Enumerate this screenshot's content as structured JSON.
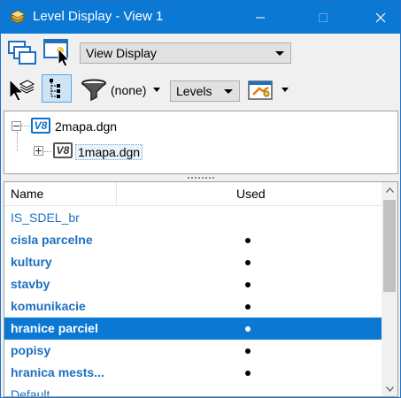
{
  "window": {
    "title": "Level Display - View 1",
    "icon": "level-stack-icon"
  },
  "toolbar": {
    "view_display": "View Display",
    "filter_value": "(none)",
    "mode_select": "Levels",
    "icons": [
      "view-group-icon",
      "view-select-icon",
      "element-select-icon",
      "tree-toggle-icon",
      "filter-icon",
      "settings-icon"
    ]
  },
  "tree": {
    "root": {
      "icon": "v8-icon",
      "label": "2mapa.dgn"
    },
    "child": {
      "icon": "v8-icon",
      "label": "1mapa.dgn"
    }
  },
  "list": {
    "col_name": "Name",
    "col_used": "Used",
    "rows": [
      {
        "name": "IS_SDEL_br",
        "bold": false,
        "used": false,
        "selected": false
      },
      {
        "name": "cisla parcelne",
        "bold": true,
        "used": true,
        "selected": false
      },
      {
        "name": "kultury",
        "bold": true,
        "used": true,
        "selected": false
      },
      {
        "name": "stavby",
        "bold": true,
        "used": true,
        "selected": false
      },
      {
        "name": "komunikacie",
        "bold": true,
        "used": true,
        "selected": false
      },
      {
        "name": "hranice parciel",
        "bold": true,
        "used": true,
        "selected": true
      },
      {
        "name": "popisy",
        "bold": true,
        "used": true,
        "selected": false
      },
      {
        "name": "hranica mests...",
        "bold": true,
        "used": true,
        "selected": false
      },
      {
        "name": "Default",
        "bold": false,
        "used": false,
        "selected": false
      }
    ]
  },
  "colors": {
    "titlebar": "#0b78d4",
    "selection": "#0b78d4",
    "level_text": "#1f6fc0"
  }
}
